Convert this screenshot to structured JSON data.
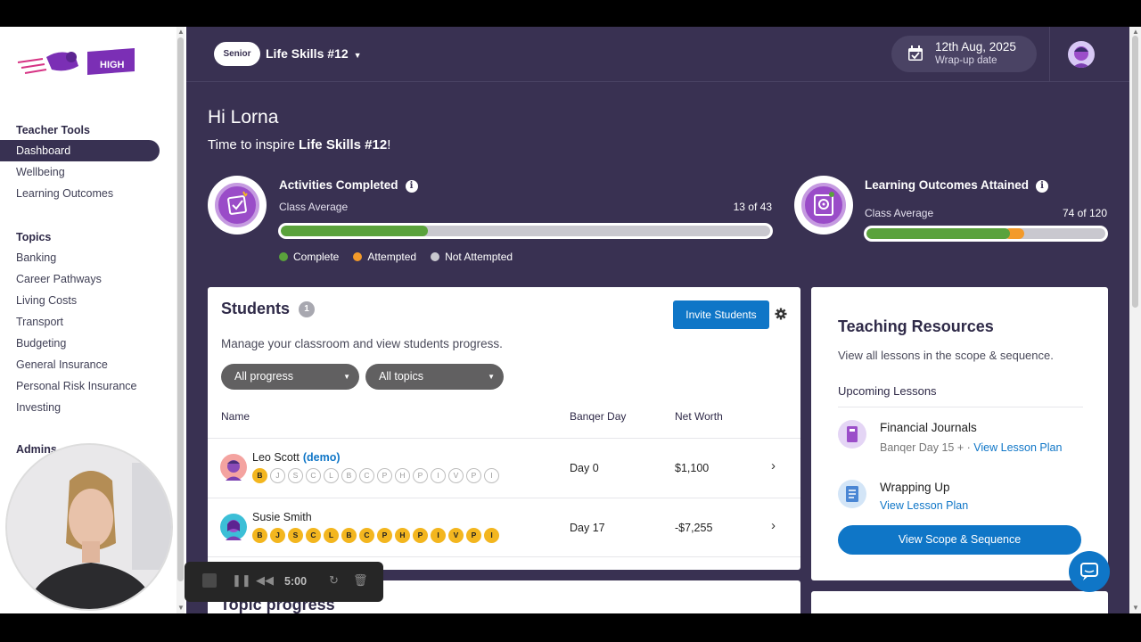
{
  "sidebar": {
    "logo_text": "HIGH",
    "sections": [
      {
        "heading": "Teacher Tools",
        "items": [
          "Dashboard",
          "Wellbeing",
          "Learning Outcomes"
        ],
        "active": "Dashboard"
      },
      {
        "heading": "Topics",
        "items": [
          "Banking",
          "Career Pathways",
          "Living Costs",
          "Transport",
          "Budgeting",
          "General Insurance",
          "Personal Risk Insurance",
          "Investing"
        ]
      },
      {
        "heading": "Admins"
      }
    ]
  },
  "header": {
    "level_badge": "Senior",
    "class_name": "Life Skills #12",
    "date": "12th Aug, 2025",
    "date_label": "Wrap-up date"
  },
  "greeting": {
    "hello": "Hi Lorna",
    "inspire_prefix": "Time to inspire ",
    "inspire_class": "Life Skills #12",
    "inspire_suffix": "!"
  },
  "activities": {
    "title": "Activities Completed",
    "sub": "Class Average",
    "count": "13 of 43",
    "complete_fraction": 0.3,
    "legend": [
      "Complete",
      "Attempted",
      "Not Attempted"
    ]
  },
  "outcomes": {
    "title": "Learning Outcomes Attained",
    "sub": "Class Average",
    "count": "74 of 120",
    "complete_fraction": 0.6,
    "attempted_fraction": 0.06
  },
  "colors": {
    "complete": "#5aa23c",
    "attempted": "#f39a2a",
    "not_attempted": "#c9c8cf",
    "primary": "#0f76c7",
    "brand": "#393152"
  },
  "students": {
    "title": "Students",
    "count": "1",
    "invite_label": "Invite Students",
    "description": "Manage your classroom and view students progress.",
    "filter_progress": "All progress",
    "filter_topics": "All topics",
    "columns": [
      "Name",
      "Banqer Day",
      "Net Worth"
    ],
    "rows": [
      {
        "name": "Leo Scott",
        "tag": "(demo)",
        "day": "Day 0",
        "net_worth": "$1,100",
        "chips": [
          "B",
          "J",
          "S",
          "C",
          "L",
          "B",
          "C",
          "P",
          "H",
          "P",
          "I",
          "V",
          "P",
          "I"
        ],
        "done": 1
      },
      {
        "name": "Susie Smith",
        "tag": "",
        "day": "Day 17",
        "net_worth": "-$7,255",
        "chips": [
          "B",
          "J",
          "S",
          "C",
          "L",
          "B",
          "C",
          "P",
          "H",
          "P",
          "I",
          "V",
          "P",
          "I"
        ],
        "done": 14
      }
    ]
  },
  "topic_progress": {
    "title": "Topic progress"
  },
  "resources": {
    "title": "Teaching Resources",
    "sub": "View all lessons in the scope & sequence.",
    "upcoming": "Upcoming Lessons",
    "lessons": [
      {
        "name": "Financial Journals",
        "meta": "Banqer Day 15 + · ",
        "link": "View Lesson Plan"
      },
      {
        "name": "Wrapping Up",
        "meta": "",
        "link": "View Lesson Plan"
      }
    ],
    "scope_button": "View Scope & Sequence"
  },
  "recorder": {
    "time": "5:00"
  }
}
